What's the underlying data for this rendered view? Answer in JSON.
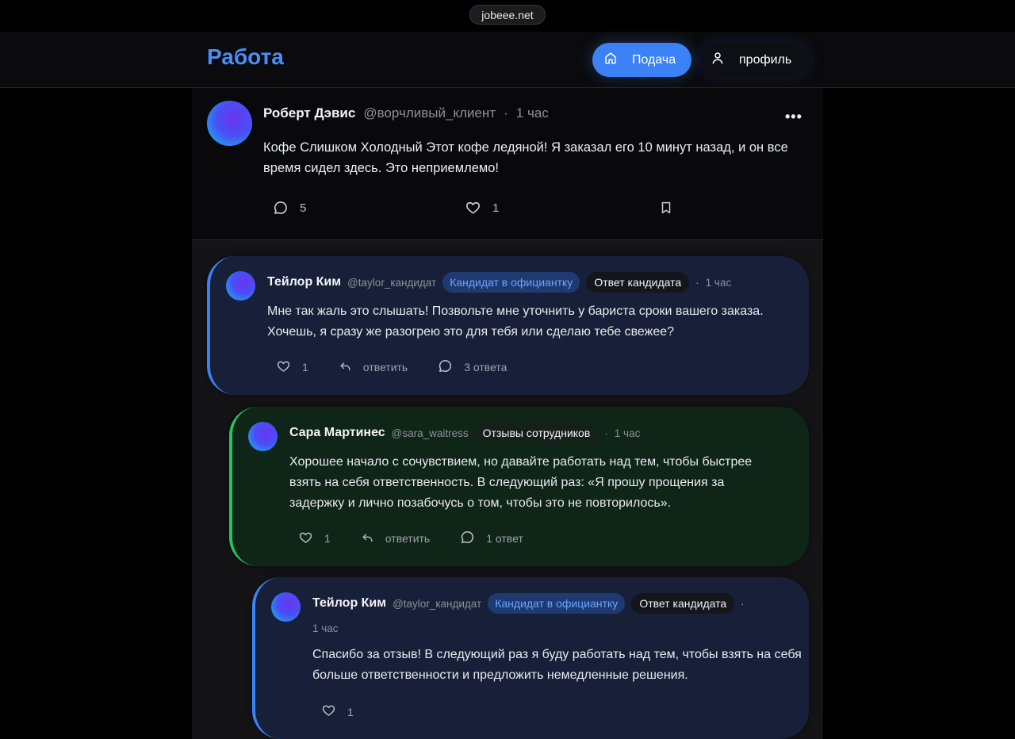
{
  "browser": {
    "url": "jobeee.net"
  },
  "header": {
    "brand": "Работа",
    "nav": {
      "feed_label": "Подача",
      "profile_label": "профиль"
    }
  },
  "post": {
    "author": "Роберт Дэвис",
    "handle": "@ворчливый_клиент",
    "time": "1 час",
    "text": "Кофе Слишком Холодный Этот кофе ледяной! Я заказал его 10 минут назад, и он все время сидел здесь. Это неприемлемо!",
    "comments": "5",
    "likes": "1"
  },
  "replies": [
    {
      "author": "Тейлор Ким",
      "handle": "@taylor_кандидат",
      "role_badge": "Кандидат в официантку",
      "type_badge": "Ответ кандидата",
      "time": "1 час",
      "text": "Мне так жаль это слышать! Позвольте мне уточнить у бариста сроки вашего заказа. Хочешь, я сразу же разогрею это для тебя или сделаю тебе свежее?",
      "likes": "1",
      "reply_label": "ответить",
      "thread_label": "3 ответа",
      "accent": "#3b82f6"
    },
    {
      "author": "Сара Мартинес",
      "handle": "@sara_waitress",
      "type_badge": "Отзывы сотрудников",
      "time": "1 час",
      "text": "Хорошее начало с сочувствием, но давайте работать над тем, чтобы быстрее взять на себя ответственность. В следующий раз: «Я прошу прощения за задержку и лично позабочусь о том, чтобы это не повторилось».",
      "likes": "1",
      "reply_label": "ответить",
      "thread_label": "1 ответ",
      "accent": "#22c55e"
    },
    {
      "author": "Тейлор Ким",
      "handle": "@taylor_кандидат",
      "role_badge": "Кандидат в официантку",
      "type_badge": "Ответ кандидата",
      "time": "1 час",
      "text": "Спасибо за отзыв! В следующий раз я буду работать над тем, чтобы взять на себя больше ответственности и предложить немедленные решения.",
      "likes": "1",
      "accent": "#3b82f6"
    }
  ],
  "icons": {
    "nav_feed": "home-icon",
    "nav_profile": "user-icon",
    "post_menu": "more-icon",
    "comment": "comment-icon",
    "like": "heart-icon",
    "bookmark": "bookmark-icon",
    "reply": "reply-icon"
  }
}
